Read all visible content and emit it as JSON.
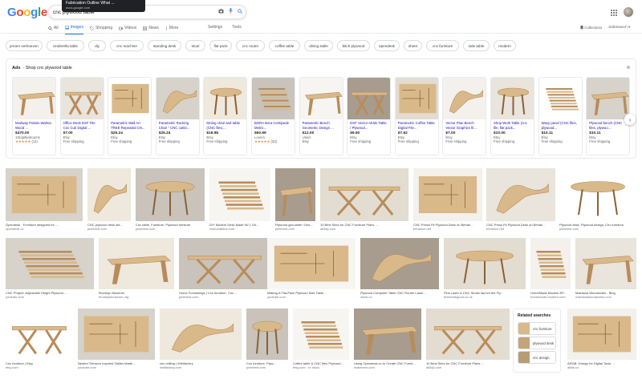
{
  "header": {
    "logo": [
      "G",
      "o",
      "o",
      "g",
      "l",
      "e"
    ],
    "query": "cnc plywood table",
    "tooltip_title": "Fabrication Outline What ...",
    "tooltip_source": "docs.google.com"
  },
  "tabs": [
    {
      "label": "All",
      "icon": "search-icon",
      "active": false
    },
    {
      "label": "Images",
      "icon": "image-icon",
      "active": true
    },
    {
      "label": "Shopping",
      "icon": "tag-icon",
      "active": false
    },
    {
      "label": "Videos",
      "icon": "video-icon",
      "active": false
    },
    {
      "label": "News",
      "icon": "news-icon",
      "active": false
    },
    {
      "label": "More",
      "icon": "more-icon",
      "active": false
    }
  ],
  "tools": [
    "Settings",
    "Tools"
  ],
  "right_links": [
    "Collections",
    "SafeSearch ▾"
  ],
  "chips": [
    "jeroen verhoeven",
    "cinderella table",
    "diy",
    "cnc machine",
    "standing desk",
    "stool",
    "flat pack",
    "cnc router",
    "coffee table",
    "dining table",
    "bitch plywood",
    "opendesk",
    "sheet",
    "cnc furniture",
    "side table",
    "modern"
  ],
  "ads": {
    "label": "Ads",
    "title": "Shop cnc plywood table",
    "items": [
      {
        "title": "Modway Polaris Walnut Wood ...",
        "price": "$470.00",
        "store": "1StopBedrooms",
        "stars": "★★★★★",
        "reviews": "(11)",
        "ship": ""
      },
      {
        "title": "Office Desk DXF File Cnc Cut/ Digital ...",
        "price": "$7.00",
        "store": "Etsy",
        "ship": "Free shipping"
      },
      {
        "title": "Parametric Wall Art TREE Repeated CN...",
        "price": "$25.24",
        "store": "Etsy",
        "ship": "Free shipping"
      },
      {
        "title": "Parametric Rocking Chair '' CNC cuttin...",
        "price": "$25.24",
        "store": "Etsy",
        "ship": "Free shipping"
      },
      {
        "title": "Dining chair and table (CNC files,...",
        "price": "$18.95",
        "store": "Etsy",
        "ship": "Free shipping"
      },
      {
        "title": "BORA Bora Centipede Metric...",
        "price": "$60.99",
        "store": "Lovers",
        "stars": "★★★★★",
        "reviews": "(33)",
        "ship": ""
      },
      {
        "title": "Parametric Bench Geometric Design ...",
        "price": "$12.00",
        "store": "Used",
        "ship": "Etsy"
      },
      {
        "title": "DXF Vector AKids Table / Plywood...",
        "price": "$9.50",
        "store": "Etsy",
        "ship": "Free shipping"
      },
      {
        "title": "Parametric Coffee Table Digital File...",
        "price": "$7.62",
        "store": "Etsy",
        "ship": "Free shipping"
      },
      {
        "title": "Vector Plan Bench Vector Graphics fil...",
        "price": "$7.00",
        "store": "Etsy",
        "ship": "Free shipping"
      },
      {
        "title": "Shop Work Table (cnc file, flat pack...",
        "price": "$10.00",
        "store": "Etsy",
        "ship": "Free shipping"
      },
      {
        "title": "Wavy panel (CNC files, plywood...",
        "price": "$10.11",
        "store": "Etsy",
        "ship": "Free shipping"
      },
      {
        "title": "Plywood bench (CNC files, plywoo...",
        "price": "$10.11",
        "store": "Etsy",
        "ship": "Free shipping"
      }
    ]
  },
  "results": [
    {
      "title": "Opendesk · Furniture designed for ...",
      "source": "opendesk.cc"
    },
    {
      "title": "CNC plywood desk wit...",
      "source": "pinterest.com"
    },
    {
      "title": "Cnc table, Furniture, Plywood furniture",
      "source": "pinterest.com"
    },
    {
      "title": "DIY Modern Desk Made W/ 1 Sh...",
      "source": "instructables.com"
    },
    {
      "title": "Plywood geo-table / Des...",
      "source": "pinterest.com"
    },
    {
      "title": "10 Best Sites for CNC Furniture Plans ...",
      "source": "all3dp.com"
    },
    {
      "title": "CNC Pressi Fit Plywood Desk on Behan...",
      "source": "behance.net"
    },
    {
      "title": "CNC Press Fit Plywood Desk on Behan...",
      "source": "behance.net"
    },
    {
      "title": "Plywood desk, Plywood design, Cnc furniture",
      "source": "pinterest.com"
    },
    {
      "title": "CNC Project: Adjustable Height Plywood ...",
      "source": "youtube.com"
    },
    {
      "title": "Brooklyn Museum",
      "source": "brooklynmuseum.org"
    },
    {
      "title": "Home Furnishings | Cnc furniture, Cnc ...",
      "source": "pinterest.com"
    },
    {
      "title": "Making A Flat-Pack Plywood Side Table ...",
      "source": "youtube.com"
    },
    {
      "title": "Plywood Computer Table CNC Router Laser ...",
      "source": "3axis.co"
    },
    {
      "title": "Plus Laser & CNC Studio launch the Fly...",
      "source": "thewholegood.co.uk"
    },
    {
      "title": "HomeMade Modern EP...",
      "source": "homemade-modern.com"
    },
    {
      "title": "Mainland Woodworks - Blog",
      "source": "mainlandwoodworks.com"
    },
    {
      "title": "Cnc furniture | Etsy",
      "source": "etsy.com"
    },
    {
      "title": "Nested Terrazzo Inspired Tables Made ...",
      "source": "youtube.com"
    },
    {
      "title": "cnc-milling | Wikifactory",
      "source": "wikifactory.com"
    },
    {
      "title": "Cnc furniture, Plyw...",
      "source": "pinterest.com"
    },
    {
      "title": "Coffee table & CNC files Plywood...",
      "source": "etsy.com · In stock"
    },
    {
      "title": "Using Opendesk.cc to Create CNC Furnit...",
      "source": "makezine.com"
    },
    {
      "title": "10 Best Sites for CNC Furniture Plans ...",
      "source": "all3dp.com"
    },
    {
      "title": "AtFAB: Design for Digital Tools ...",
      "source": "atfab.co"
    }
  ],
  "related": {
    "title": "Related searches",
    "items": [
      "cnc furniture",
      "plywood desk",
      "cnc design"
    ]
  }
}
